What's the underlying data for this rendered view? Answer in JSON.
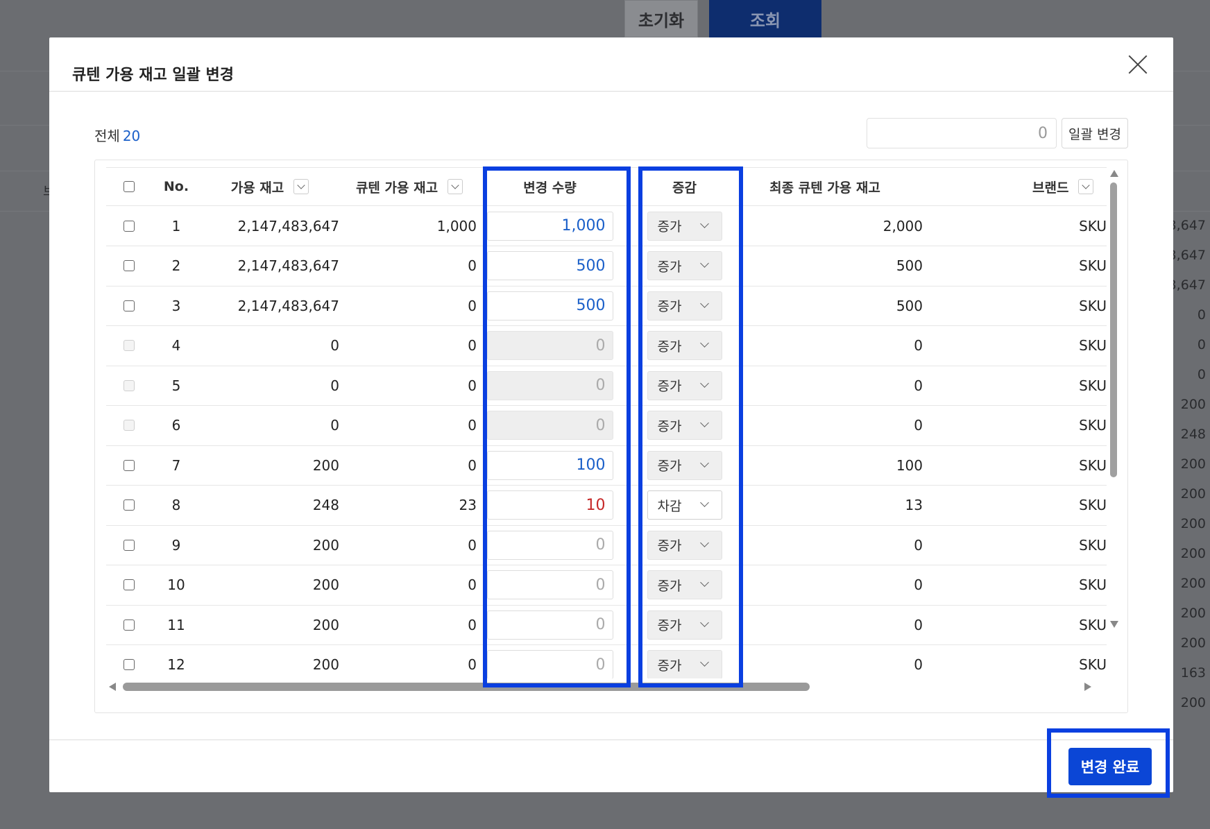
{
  "background": {
    "reset_label": "초기화",
    "search_label": "조회",
    "side_label": "브",
    "numbers": [
      "3,647",
      "3,647",
      "3,647",
      "0",
      "0",
      "0",
      "200",
      "248",
      "200",
      "200",
      "200",
      "200",
      "200",
      "200",
      "200",
      "163",
      "200"
    ]
  },
  "modal": {
    "title": "큐텐 가용 재고 일괄 변경",
    "total_label": "전체",
    "total_count": "20",
    "bulk_input_value": "0",
    "bulk_button_label": "일괄 변경",
    "done_button_label": "변경 완료"
  },
  "table": {
    "headers": {
      "no": "No.",
      "available": "가용 재고",
      "qten_available": "큐텐 가용 재고",
      "change_qty": "변경 수량",
      "inc_dec": "증감",
      "final": "최종 큐텐 가용 재고",
      "brand": "브랜드"
    },
    "rows": [
      {
        "no": "1",
        "available": "2,147,483,647",
        "qten": "1,000",
        "change": "1,000",
        "op": "증가",
        "final": "2,000",
        "brand": "SKU"
      },
      {
        "no": "2",
        "available": "2,147,483,647",
        "qten": "0",
        "change": "500",
        "op": "증가",
        "final": "500",
        "brand": "SKU"
      },
      {
        "no": "3",
        "available": "2,147,483,647",
        "qten": "0",
        "change": "500",
        "op": "증가",
        "final": "500",
        "brand": "SKU"
      },
      {
        "no": "4",
        "available": "0",
        "qten": "0",
        "change": "0",
        "op": "증가",
        "final": "0",
        "brand": "SKU"
      },
      {
        "no": "5",
        "available": "0",
        "qten": "0",
        "change": "0",
        "op": "증가",
        "final": "0",
        "brand": "SKU"
      },
      {
        "no": "6",
        "available": "0",
        "qten": "0",
        "change": "0",
        "op": "증가",
        "final": "0",
        "brand": "SKU"
      },
      {
        "no": "7",
        "available": "200",
        "qten": "0",
        "change": "100",
        "op": "증가",
        "final": "100",
        "brand": "SKU"
      },
      {
        "no": "8",
        "available": "248",
        "qten": "23",
        "change": "10",
        "op": "차감",
        "final": "13",
        "brand": "SKU"
      },
      {
        "no": "9",
        "available": "200",
        "qten": "0",
        "change": "0",
        "op": "증가",
        "final": "0",
        "brand": "SKU"
      },
      {
        "no": "10",
        "available": "200",
        "qten": "0",
        "change": "0",
        "op": "증가",
        "final": "0",
        "brand": "SKU"
      },
      {
        "no": "11",
        "available": "200",
        "qten": "0",
        "change": "0",
        "op": "증가",
        "final": "0",
        "brand": "SKU"
      },
      {
        "no": "12",
        "available": "200",
        "qten": "0",
        "change": "0",
        "op": "증가",
        "final": "0",
        "brand": "SKU"
      }
    ]
  },
  "colors": {
    "highlight": "#0a3fe0",
    "positive_value": "#1a5fc9",
    "negative_value": "#c62828",
    "primary_button": "#0b46d6"
  }
}
